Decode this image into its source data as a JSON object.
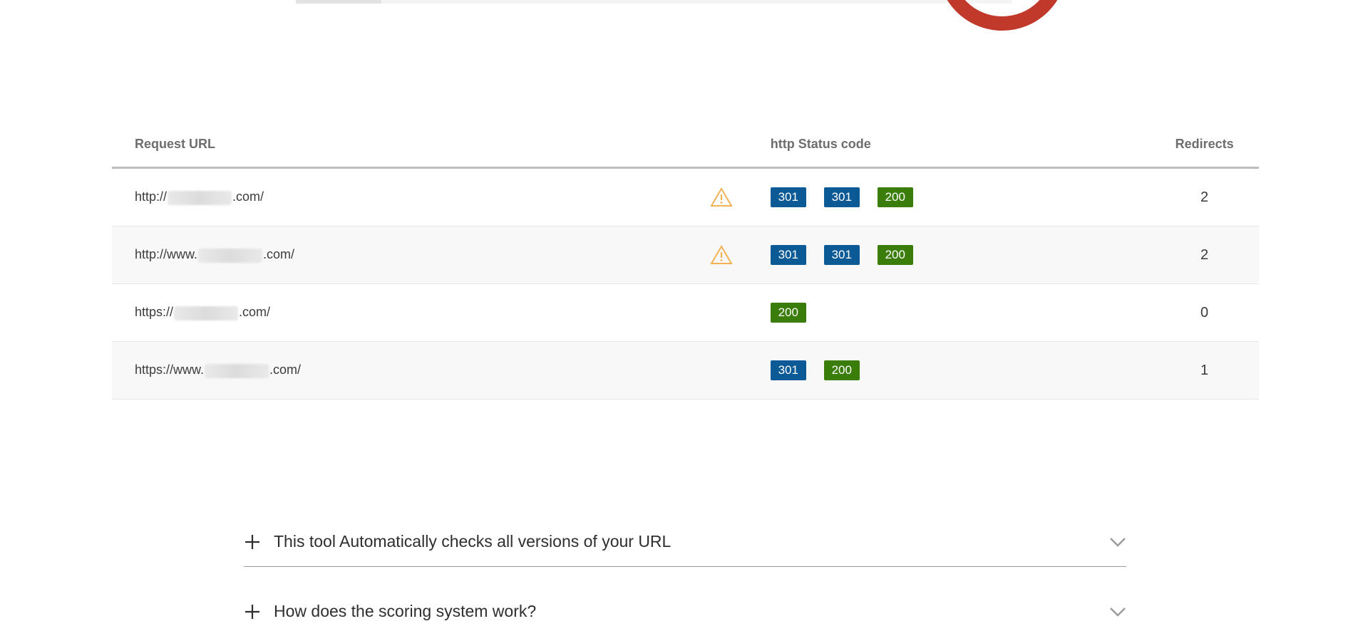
{
  "table": {
    "headers": {
      "url": "Request URL",
      "status": "http Status code",
      "redirects": "Redirects"
    },
    "rows": [
      {
        "url_prefix": "http://",
        "url_suffix": ".com/",
        "warning": true,
        "codes": [
          "301",
          "301",
          "200"
        ],
        "redirects": "2"
      },
      {
        "url_prefix": "http://www.",
        "url_suffix": ".com/",
        "warning": true,
        "codes": [
          "301",
          "301",
          "200"
        ],
        "redirects": "2"
      },
      {
        "url_prefix": "https://",
        "url_suffix": ".com/",
        "warning": false,
        "codes": [
          "200"
        ],
        "redirects": "0"
      },
      {
        "url_prefix": "https://www.",
        "url_suffix": ".com/",
        "warning": false,
        "codes": [
          "301",
          "200"
        ],
        "redirects": "1"
      }
    ]
  },
  "faq": {
    "items": [
      {
        "question": "This tool Automatically checks all versions of your URL"
      },
      {
        "question": "How does the scoring system work?"
      }
    ]
  },
  "colors": {
    "redirect_badge": "#0b5a96",
    "ok_badge": "#3a7d0a",
    "warning": "#f0b254",
    "score_ring": "#c0392b"
  },
  "icons": {
    "warning": "warning-triangle-icon",
    "expand": "plus-icon",
    "chevron": "chevron-down-icon"
  }
}
